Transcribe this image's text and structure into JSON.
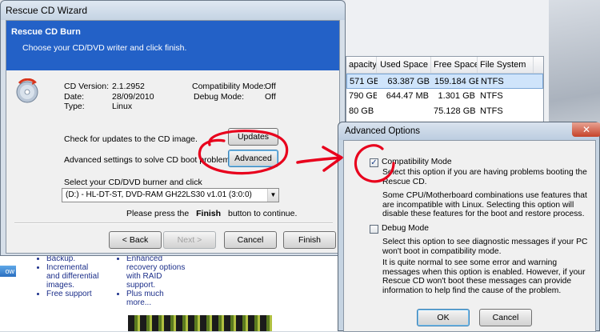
{
  "background": {
    "table": {
      "headers": [
        "apacity",
        "Used Space",
        "Free Space",
        "File System"
      ],
      "rows": [
        [
          "571 GB",
          "63.387 GB",
          "159.184 GB",
          "NTFS"
        ],
        [
          "790 GB",
          "644.47 MB",
          "1.301 GB",
          "NTFS"
        ],
        [
          "80 GB",
          "",
          "75.128 GB",
          "NTFS"
        ]
      ]
    },
    "ad": {
      "view_button": "ow",
      "col1": [
        "Backup.",
        "Incremental and differential images.",
        "Free support"
      ],
      "col2": [
        "Enhanced recovery options with RAID support.",
        "Plus much more..."
      ]
    }
  },
  "wizard": {
    "title": "Rescue CD Wizard",
    "header_title": "Rescue CD Burn",
    "header_subtitle": "Choose your CD/DVD writer and click finish.",
    "cd_version_label": "CD Version:",
    "cd_version": "2.1.2952",
    "date_label": "Date:",
    "date": "28/09/2010",
    "type_label": "Type:",
    "type": "Linux",
    "compat_label": "Compatibility Mode:",
    "compat_value": "Off",
    "debug_label": "Debug Mode:",
    "debug_value": "Off",
    "updates_text": "Check for updates to the CD image.",
    "updates_button": "Updates",
    "advanced_text": "Advanced settings to solve CD boot problems.",
    "advanced_button": "Advanced",
    "burner_prompt": "Select your CD/DVD burner and click",
    "burner_selected": "(D:) - HL-DT-ST, DVD-RAM GH22LS30 v1.01 (3:0:0)",
    "press_prefix": "Please press the",
    "press_finish": "Finish",
    "press_suffix": "button to continue.",
    "back_button": "< Back",
    "next_button": "Next >",
    "cancel_button": "Cancel",
    "finish_button": "Finish"
  },
  "advanced": {
    "title": "Advanced Options",
    "close": "✕",
    "compat_checkbox": "Compatibility Mode",
    "compat_checked": true,
    "compat_desc1": "Select this option if you are having problems booting the Rescue CD.",
    "compat_desc2": "Some CPU/Motherboard combinations use features that are incompatible with Linux. Selecting this option will disable these features for the boot and restore process.",
    "debug_checkbox": "Debug Mode",
    "debug_checked": false,
    "debug_desc1": "Select this option to see diagnostic messages if your PC won't boot in compatibility mode.",
    "debug_desc2": "It is quite normal to see some error and warning messages when this option is enabled. However, if your Rescue CD won't boot these messages can provide information to help find the cause of the problem.",
    "ok_button": "OK",
    "cancel_button": "Cancel"
  },
  "colors": {
    "header_blue": "#2361c7",
    "annotation_red": "#e8001c"
  }
}
